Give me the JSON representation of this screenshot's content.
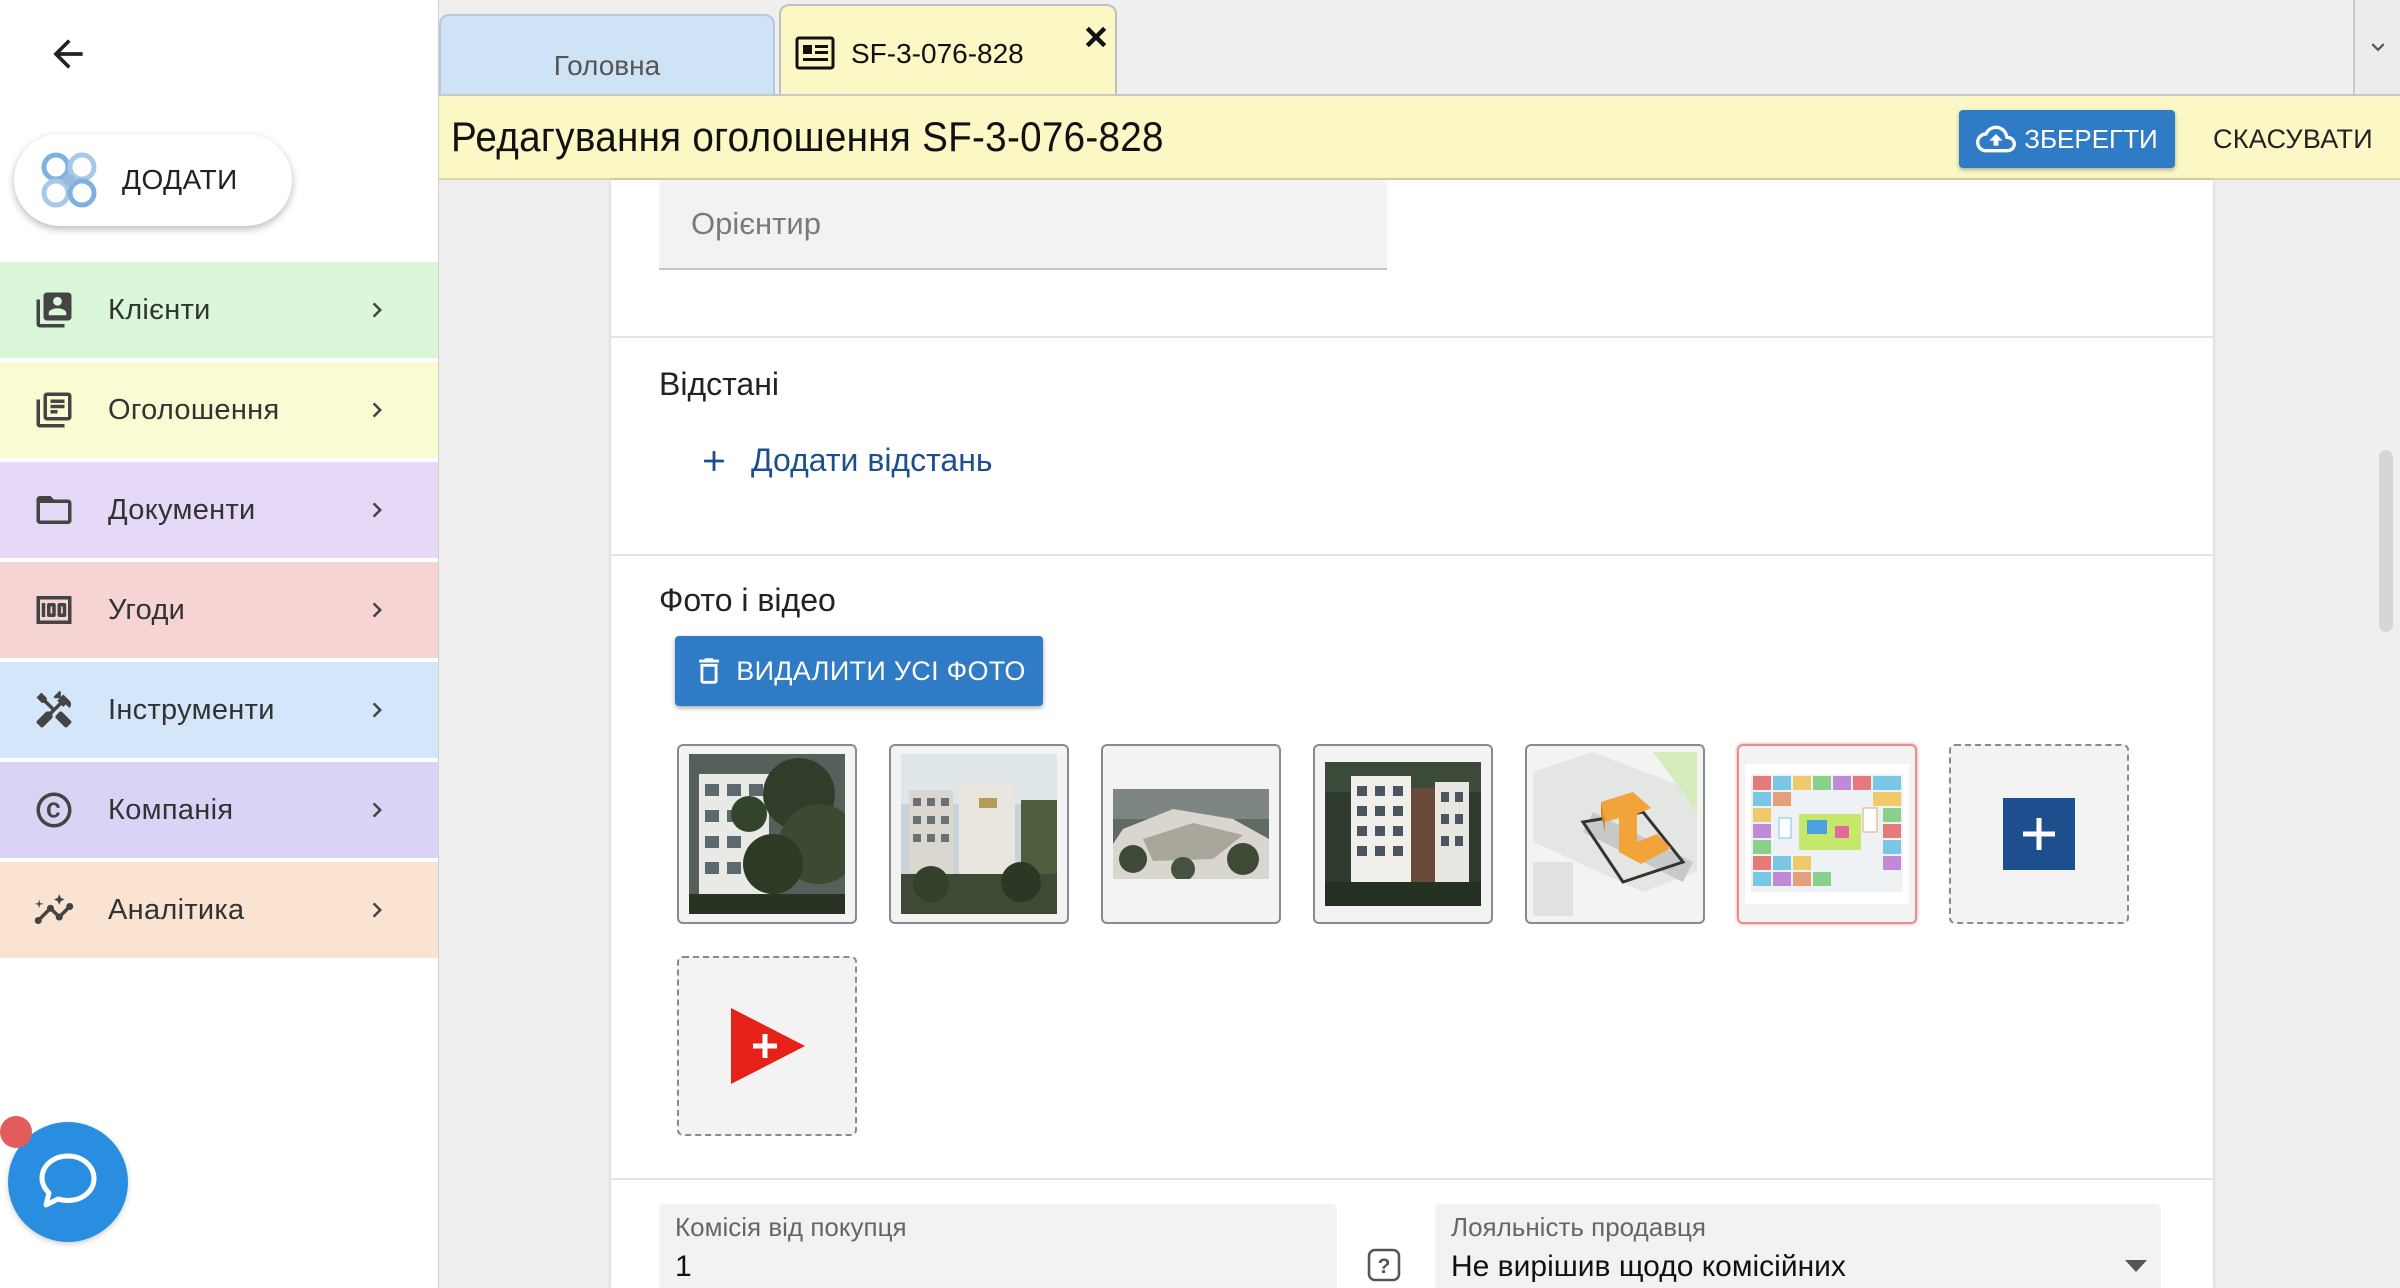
{
  "sidebar": {
    "add_button_label": "ДОДАТИ",
    "items": [
      {
        "label": "Клієнти",
        "icon": "clients-icon",
        "bg": "#dbf7da"
      },
      {
        "label": "Оголошення",
        "icon": "listings-icon",
        "bg": "#fafbd2"
      },
      {
        "label": "Документи",
        "icon": "folder-icon",
        "bg": "#e6d8f7"
      },
      {
        "label": "Угоди",
        "icon": "money-icon",
        "bg": "#f7d4d4"
      },
      {
        "label": "Інструменти",
        "icon": "tools-icon",
        "bg": "#d4e6f9"
      },
      {
        "label": "Компанія",
        "icon": "copyright-icon",
        "bg": "#d9d3f5"
      },
      {
        "label": "Аналітика",
        "icon": "analytics-icon",
        "bg": "#fbe3d1"
      }
    ]
  },
  "tabs": {
    "home": {
      "label": "Головна"
    },
    "active": {
      "label": "SF-3-076-828"
    }
  },
  "titlebar": {
    "title": "Редагування оголошення SF-3-076-828",
    "save_label": "ЗБЕРЕГТИ",
    "cancel_label": "СКАСУВАТИ"
  },
  "form": {
    "landmark_placeholder": "Орієнтир",
    "distances_title": "Відстані",
    "add_distance_label": "Додати відстань",
    "photos_title": "Фото і відео",
    "delete_all_label": "ВИДАЛИТИ УСІ ФОТО",
    "photos": [
      {
        "name": "photo-1",
        "desc": "building with trees"
      },
      {
        "name": "photo-2",
        "desc": "building front"
      },
      {
        "name": "photo-3",
        "desc": "aerial view"
      },
      {
        "name": "photo-4",
        "desc": "building render"
      },
      {
        "name": "photo-5",
        "desc": "site plan 3d"
      },
      {
        "name": "photo-6",
        "desc": "floor plan",
        "selected": true
      }
    ],
    "commission_label": "Комісія від покупця",
    "commission_value": "1",
    "loyalty_label": "Лояльність продавця",
    "loyalty_value": "Не вирішив щодо комісійних"
  },
  "colors": {
    "accent": "#2f7bc6",
    "title_bg": "#fbf8c6",
    "home_tab_bg": "#cfe3f7",
    "link": "#1d4f8f",
    "chat": "#2a8ee0",
    "youtube_red": "#e62117"
  }
}
